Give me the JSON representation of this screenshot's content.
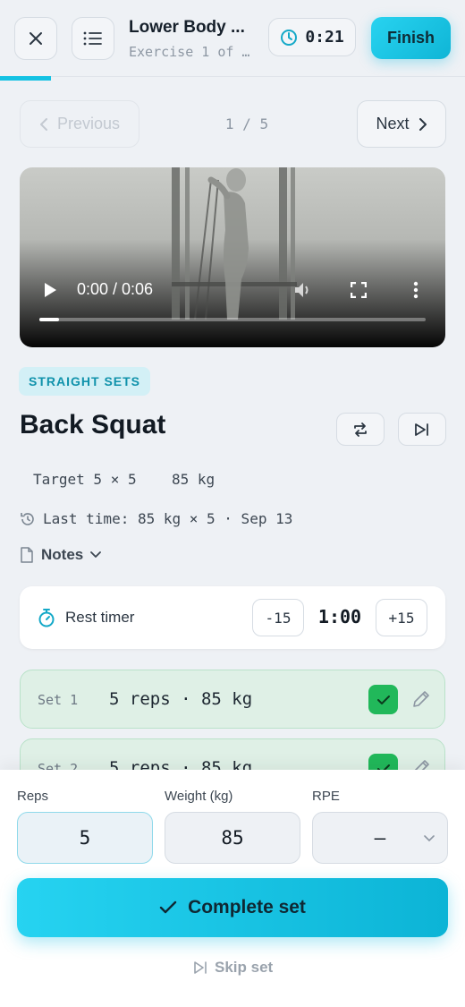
{
  "header": {
    "title": "Lower Body ...",
    "subtitle": "Exercise 1 of …",
    "elapsed": "0:21",
    "finish_label": "Finish",
    "progress": 0.11
  },
  "pager": {
    "prev_label": "Previous",
    "next_label": "Next",
    "count": "1 / 5"
  },
  "video": {
    "time": "0:00 / 0:06",
    "played_fraction": 0.05
  },
  "exercise": {
    "tag": "STRAIGHT SETS",
    "name": "Back Squat",
    "target": "Target 5 × 5",
    "target_weight": "85 kg",
    "last_time": "Last time: 85 kg × 5 · Sep 13",
    "notes_label": "Notes"
  },
  "rest_timer": {
    "label": "Rest timer",
    "minus": "-15",
    "value": "1:00",
    "plus": "+15"
  },
  "sets": [
    {
      "label": "Set 1",
      "value": "5 reps · 85 kg",
      "done": true
    },
    {
      "label": "Set 2",
      "value": "5 reps · 85 kg",
      "done": true
    }
  ],
  "inputs": {
    "reps_label": "Reps",
    "reps_value": "5",
    "weight_label": "Weight (kg)",
    "weight_value": "85",
    "rpe_label": "RPE",
    "rpe_value": "–"
  },
  "actions": {
    "complete_label": "Complete set",
    "skip_label": "Skip set"
  },
  "colors": {
    "accent": "#14c2e3",
    "done_green": "#21b85a"
  }
}
